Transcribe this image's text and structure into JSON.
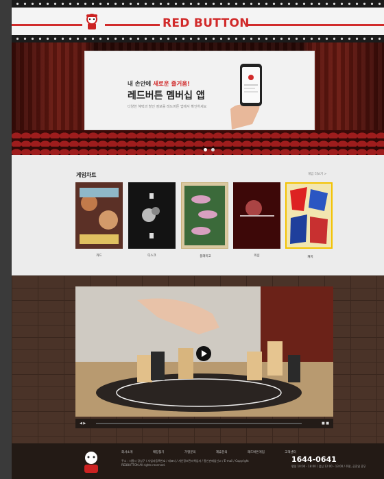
{
  "header": {
    "brand": "RED BUTTON"
  },
  "hero": {
    "line1_prefix": "내 손안에 ",
    "line1_highlight": "새로운 즐거움!",
    "line2": "레드버튼 멤버십 앱",
    "desc": "다양한 혜택과 할인 정보를 레드버튼 앱에서 확인하세요",
    "slider_dots": 2,
    "slider_active": 1
  },
  "chart": {
    "title": "게임차트",
    "more_label": "게임 더보기 >",
    "items": [
      {
        "label": "카드"
      },
      {
        "label": "디스크"
      },
      {
        "label": "플래미고"
      },
      {
        "label": "의심"
      },
      {
        "label": "캐치"
      }
    ]
  },
  "video": {
    "play_icon": "play-icon",
    "time_left": "◀ ▶",
    "time_right": "■ ■"
  },
  "footer": {
    "nav": [
      "회사소개",
      "매장찾기",
      "가맹문의",
      "제휴문의",
      "레드버튼게임",
      "고객센터"
    ],
    "info": "주소 : 서울시 강남구 / 사업자등록번호 / 대표자 / 개인정보관리책임자 / 통신판매업신고 / E-mail / Copyright REDBUTTON All rights reserved.",
    "tel": "1644-0641",
    "tel_sub": "평일 10:00 - 18:00 / 점심 12:00 - 13:00 / 주말, 공휴일 휴무"
  }
}
